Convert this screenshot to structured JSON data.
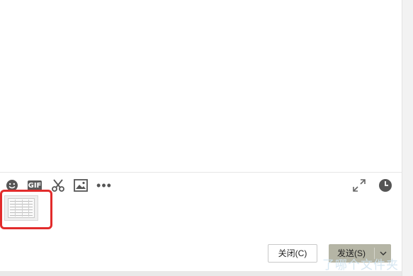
{
  "toolbar": {
    "emoji_icon": "emoji-icon",
    "gif_label": "GIF",
    "scissors_icon": "scissors-icon",
    "image_icon": "image-icon",
    "more_icon": "more-icon",
    "expand_icon": "expand-icon",
    "history_icon": "clock-icon"
  },
  "attachment": {
    "icon": "spreadsheet-thumbnail"
  },
  "buttons": {
    "close_label": "关闭(C)",
    "send_label": "发送(S)"
  },
  "watermark": "了哪个文件夹",
  "colors": {
    "highlight": "#e22b2b",
    "send_button_bg": "#b5b5a5"
  }
}
